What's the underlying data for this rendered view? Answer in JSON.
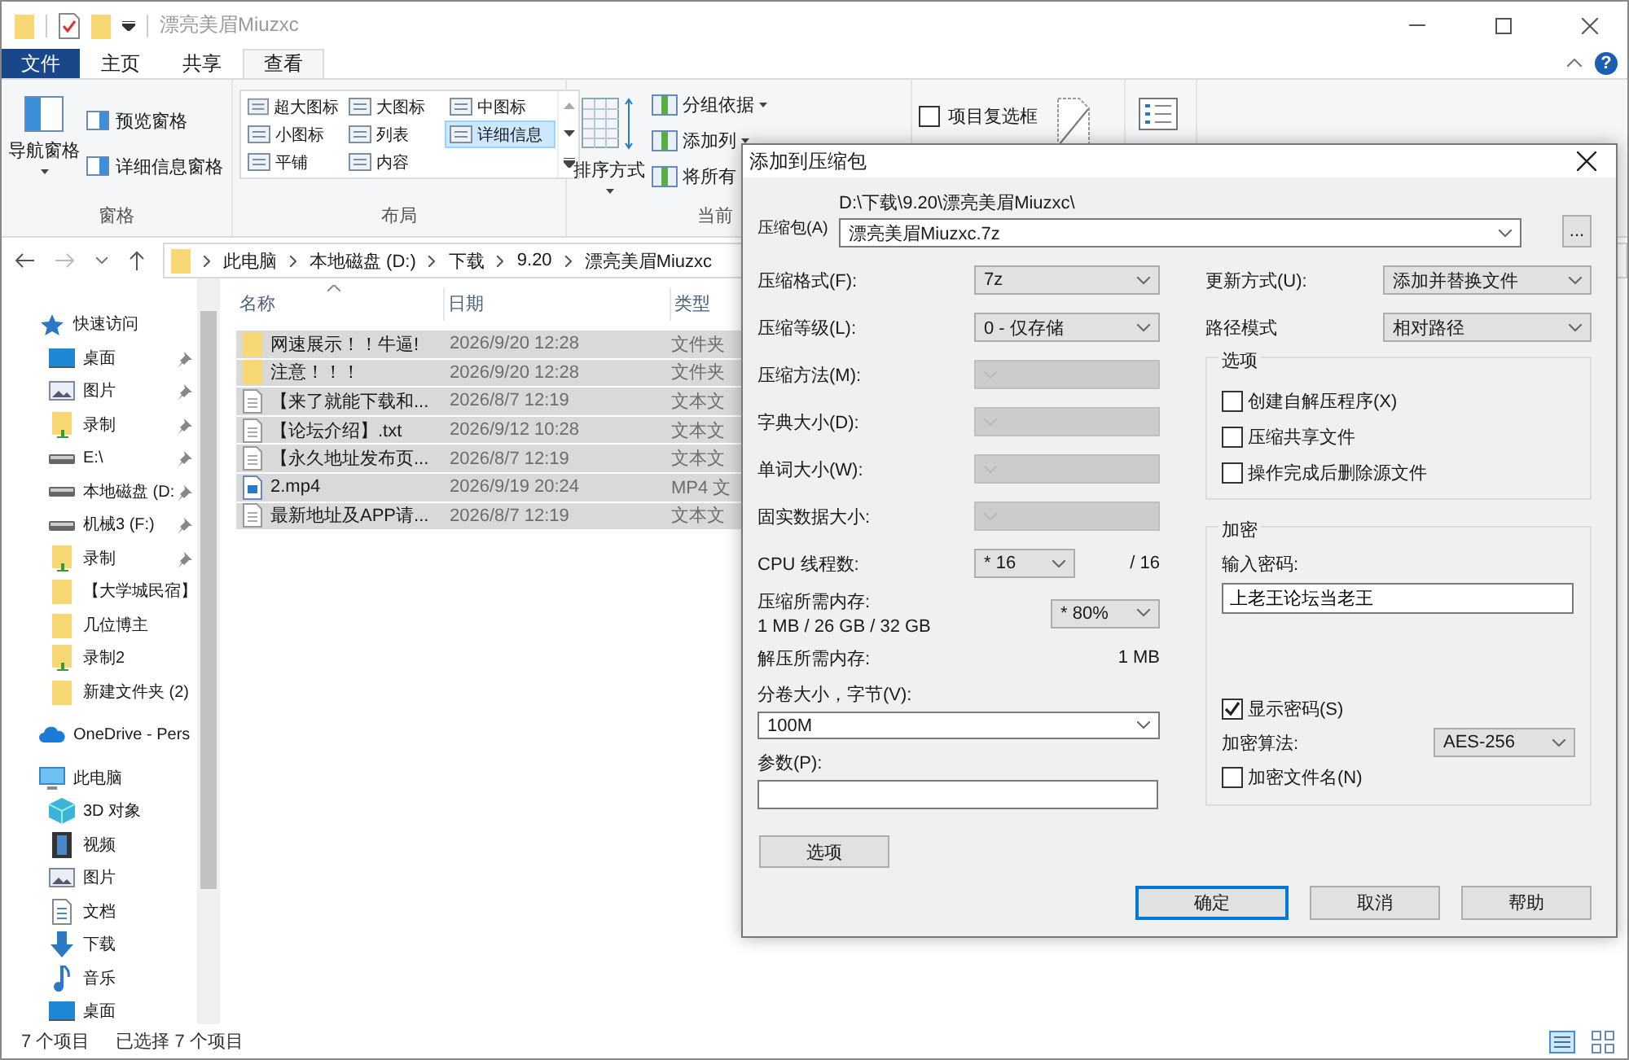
{
  "window": {
    "title": "漂亮美眉Miuzxc",
    "help": "?"
  },
  "ribbon_tabs": [
    {
      "label": "文件",
      "kind": "file",
      "selected": false
    },
    {
      "label": "主页",
      "kind": "tab",
      "selected": false
    },
    {
      "label": "共享",
      "kind": "tab",
      "selected": false
    },
    {
      "label": "查看",
      "kind": "tab",
      "selected": true
    }
  ],
  "ribbon": {
    "panes": {
      "label": "窗格",
      "nav_pane": "导航窗格",
      "items": [
        "预览窗格",
        "详细信息窗格"
      ]
    },
    "layout": {
      "label": "布局",
      "options": [
        {
          "label": "超大图标",
          "selected": false
        },
        {
          "label": "大图标",
          "selected": false
        },
        {
          "label": "中图标",
          "selected": false
        },
        {
          "label": "小图标",
          "selected": false
        },
        {
          "label": "列表",
          "selected": false
        },
        {
          "label": "详细信息",
          "selected": true
        },
        {
          "label": "平铺",
          "selected": false
        },
        {
          "label": "内容",
          "selected": false
        }
      ]
    },
    "current_view": {
      "label": "当前",
      "sort": "排序方式",
      "items": [
        {
          "label": "分组依据",
          "dropdown": true
        },
        {
          "label": "添加列",
          "dropdown": true
        },
        {
          "label": "将所有",
          "dropdown": false
        }
      ]
    },
    "show_hide": {
      "items": [
        {
          "label": "项目复选框",
          "checked": false
        }
      ]
    }
  },
  "address": {
    "path": [
      "此电脑",
      "本地磁盘 (D:)",
      "下载",
      "9.20",
      "漂亮美眉Miuzxc"
    ]
  },
  "nav": [
    {
      "label": "快速访问",
      "kind": "star",
      "children": [
        {
          "label": "桌面",
          "kind": "desktop",
          "pinned": true
        },
        {
          "label": "图片",
          "kind": "pictures",
          "pinned": true
        },
        {
          "label": "录制",
          "kind": "folder-user",
          "pinned": true
        },
        {
          "label": "E:\\",
          "kind": "drive",
          "pinned": true
        },
        {
          "label": "本地磁盘 (D:",
          "kind": "drive",
          "pinned": true
        },
        {
          "label": "机械3 (F:)",
          "kind": "drive",
          "pinned": true
        },
        {
          "label": "录制",
          "kind": "folder-user",
          "pinned": true
        },
        {
          "label": "【大学城民宿】",
          "kind": "folder",
          "pinned": false
        },
        {
          "label": "几位博主",
          "kind": "folder",
          "pinned": false
        },
        {
          "label": "录制2",
          "kind": "folder-user",
          "pinned": false
        },
        {
          "label": "新建文件夹 (2)",
          "kind": "folder",
          "pinned": false
        }
      ]
    },
    {
      "label": "OneDrive - Pers",
      "kind": "cloud"
    },
    {
      "label": "此电脑",
      "kind": "pc",
      "children": [
        {
          "label": "3D 对象",
          "kind": "cube",
          "pinned": false
        },
        {
          "label": "视频",
          "kind": "video",
          "pinned": false
        },
        {
          "label": "图片",
          "kind": "pictures",
          "pinned": false
        },
        {
          "label": "文档",
          "kind": "document",
          "pinned": false
        },
        {
          "label": "下载",
          "kind": "download",
          "pinned": false
        },
        {
          "label": "音乐",
          "kind": "music",
          "pinned": false
        },
        {
          "label": "桌面",
          "kind": "desktop",
          "pinned": false
        }
      ]
    }
  ],
  "files": {
    "columns": [
      "名称",
      "日期",
      "类型"
    ],
    "rows": [
      {
        "name": "网速展示！！牛逼!",
        "date": "2026/9/20 12:28",
        "type": "文件夹",
        "kind": "folder",
        "selected": true
      },
      {
        "name": "注意！！！",
        "date": "2026/9/20 12:28",
        "type": "文件夹",
        "kind": "folder",
        "selected": true
      },
      {
        "name": "【来了就能下载和...",
        "date": "2026/8/7 12:19",
        "type": "文本文",
        "kind": "text",
        "selected": true
      },
      {
        "name": "【论坛介绍】.txt",
        "date": "2026/9/12 10:28",
        "type": "文本文",
        "kind": "text",
        "selected": true
      },
      {
        "name": "【永久地址发布页...",
        "date": "2026/8/7 12:19",
        "type": "文本文",
        "kind": "text",
        "selected": true
      },
      {
        "name": "2.mp4",
        "date": "2026/9/19 20:24",
        "type": "MP4 文",
        "kind": "video",
        "selected": true
      },
      {
        "name": "最新地址及APP请...",
        "date": "2026/8/7 12:19",
        "type": "文本文",
        "kind": "text",
        "selected": true
      }
    ]
  },
  "status_bar": {
    "count": "7 个项目",
    "selection": "已选择 7 个项目"
  },
  "dialog": {
    "title": "添加到压缩包",
    "archive": {
      "label": "压缩包(A)",
      "path": "D:\\下载\\9.20\\漂亮美眉Miuzxc\\",
      "value": "漂亮美眉Miuzxc.7z",
      "browse": "..."
    },
    "fields": [
      {
        "label": "压缩格式(F):",
        "value": "7z",
        "disabled": false
      },
      {
        "label": "压缩等级(L):",
        "value": "0 - 仅存储",
        "disabled": false
      },
      {
        "label": "压缩方法(M):",
        "disabled": true
      },
      {
        "label": "字典大小(D):",
        "disabled": true
      },
      {
        "label": "单词大小(W):",
        "disabled": true
      },
      {
        "label": "固实数据大小:",
        "disabled": true
      }
    ],
    "cpu": {
      "label": "CPU 线程数:",
      "value": "* 16",
      "total": "/ 16"
    },
    "memory": {
      "label": "压缩所需内存:",
      "detail": "1 MB / 26 GB / 32 GB",
      "value": "* 80%"
    },
    "decompress_memory": {
      "label": "解压所需内存:",
      "value": "1 MB"
    },
    "volume": {
      "label": "分卷大小，字节(V):",
      "value": "100M"
    },
    "params": {
      "label": "参数(P):"
    },
    "options_button": "选项",
    "update_mode": {
      "label": "更新方式(U):",
      "value": "添加并替换文件"
    },
    "path_mode": {
      "label": "路径模式",
      "value": "相对路径"
    },
    "options": {
      "title": "选项",
      "items": [
        {
          "label": "创建自解压程序(X)",
          "checked": false
        },
        {
          "label": "压缩共享文件",
          "checked": false
        },
        {
          "label": "操作完成后删除源文件",
          "checked": false
        }
      ]
    },
    "encryption": {
      "title": "加密",
      "password_label": "输入密码:",
      "password": "上老王论坛当老王",
      "show_password": {
        "label": "显示密码(S)",
        "checked": true
      },
      "method_label": "加密算法:",
      "method": "AES-256",
      "encrypt_names": {
        "label": "加密文件名(N)",
        "checked": false
      }
    },
    "buttons": [
      {
        "label": "确定",
        "default": true
      },
      {
        "label": "取消",
        "default": false
      },
      {
        "label": "帮助",
        "default": false
      }
    ]
  }
}
